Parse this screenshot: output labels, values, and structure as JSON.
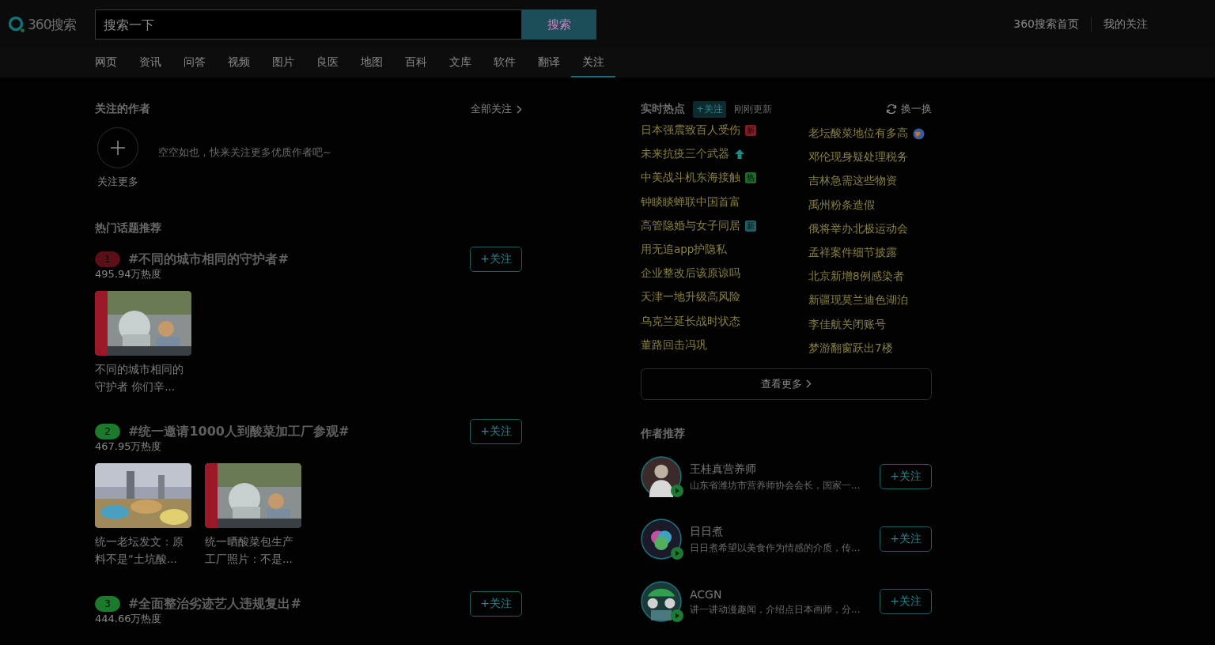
{
  "header": {
    "logo": "360搜索",
    "search": {
      "placeholder": "搜索一下",
      "button": "搜索"
    },
    "links": [
      "360搜索首页",
      "我的关注"
    ]
  },
  "nav": {
    "tabs": [
      {
        "label": "网页",
        "selected": false
      },
      {
        "label": "资讯",
        "selected": false
      },
      {
        "label": "问答",
        "selected": false
      },
      {
        "label": "视频",
        "selected": false
      },
      {
        "label": "图片",
        "selected": false
      },
      {
        "label": "良医",
        "selected": false
      },
      {
        "label": "地图",
        "selected": false
      },
      {
        "label": "百科",
        "selected": false
      },
      {
        "label": "文库",
        "selected": false
      },
      {
        "label": "软件",
        "selected": false
      },
      {
        "label": "翻译",
        "selected": false
      },
      {
        "label": "关注",
        "selected": true
      }
    ]
  },
  "followed_authors": {
    "title": "关注的作者",
    "all_link": "全部关注",
    "add_label": "关注更多",
    "empty_text": "空空如也，快来关注更多优质作者吧~"
  },
  "hot_topics": {
    "title": "热门话题推荐",
    "topics": [
      {
        "rank": "1",
        "color": "#5a1016",
        "title": "#不同的城市相同的守护者#",
        "heat": "495.94万热度",
        "follow": "+关注",
        "cards": [
          {
            "caption": "不同的城市相同的守护者 你们辛..."
          }
        ]
      },
      {
        "rank": "2",
        "color": "#1b7a2c",
        "title": "#统一邀请1000人到酸菜加工厂参观#",
        "heat": "467.95万热度",
        "follow": "+关注",
        "cards": [
          {
            "caption": "统一老坛发文：原料不是“土坑酸..."
          },
          {
            "caption": "统一晒酸菜包生产工厂照片：不是..."
          }
        ]
      },
      {
        "rank": "3",
        "color": "#1b7a2c",
        "title": "#全面整治劣迹艺人违规复出#",
        "heat": "444.66万热度",
        "follow": "+关注"
      }
    ]
  },
  "realtime": {
    "title": "实时热点",
    "follow_tag": "+关注",
    "updated": "刚刚更新",
    "refresh": "换一换",
    "more": "查看更多",
    "columns": [
      [
        {
          "text": "日本强震致百人受伤",
          "badge": {
            "kind": "text",
            "text": "新",
            "color": "#8a1a22"
          }
        },
        {
          "text": "未来抗疫三个武器",
          "badge": {
            "kind": "up"
          }
        },
        {
          "text": "中美战斗机东海接触",
          "badge": {
            "kind": "text",
            "text": "热",
            "color": "#1c6b2a"
          }
        },
        {
          "text": "钟睒睒蝉联中国首富"
        },
        {
          "text": "高管隐婚与女子同居",
          "badge": {
            "kind": "text",
            "text": "新",
            "color": "#1f5e66"
          }
        },
        {
          "text": "用无追app护隐私"
        },
        {
          "text": "企业整改后该原谅吗"
        },
        {
          "text": "天津一地升级高风险"
        },
        {
          "text": "乌克兰延长战时状态"
        },
        {
          "text": "董路回击冯巩"
        }
      ],
      [
        {
          "text": "老坛酸菜地位有多高",
          "badge": {
            "kind": "globe"
          }
        },
        {
          "text": "邓伦现身疑处理税务"
        },
        {
          "text": "吉林急需这些物资"
        },
        {
          "text": "禹州粉条造假"
        },
        {
          "text": "俄将举办北极运动会"
        },
        {
          "text": "孟祥案件细节披露"
        },
        {
          "text": "北京新增8例感染者"
        },
        {
          "text": "新疆现莫兰迪色湖泊"
        },
        {
          "text": "李佳航关闭账号"
        },
        {
          "text": "梦游翻窗跃出7楼"
        }
      ]
    ]
  },
  "authors": {
    "title": "作者推荐",
    "items": [
      {
        "name": "王桂真营养师",
        "desc": "山东省潍坊市营养师协会会长，国家一...",
        "follow": "+关注"
      },
      {
        "name": "日日煮",
        "desc": "日日煮希望以美食作为情感的介质，传...",
        "follow": "+关注"
      },
      {
        "name": "ACGN",
        "desc": "讲一讲动漫趣闻，介绍点日本画师，分...",
        "follow": "+关注"
      }
    ]
  }
}
